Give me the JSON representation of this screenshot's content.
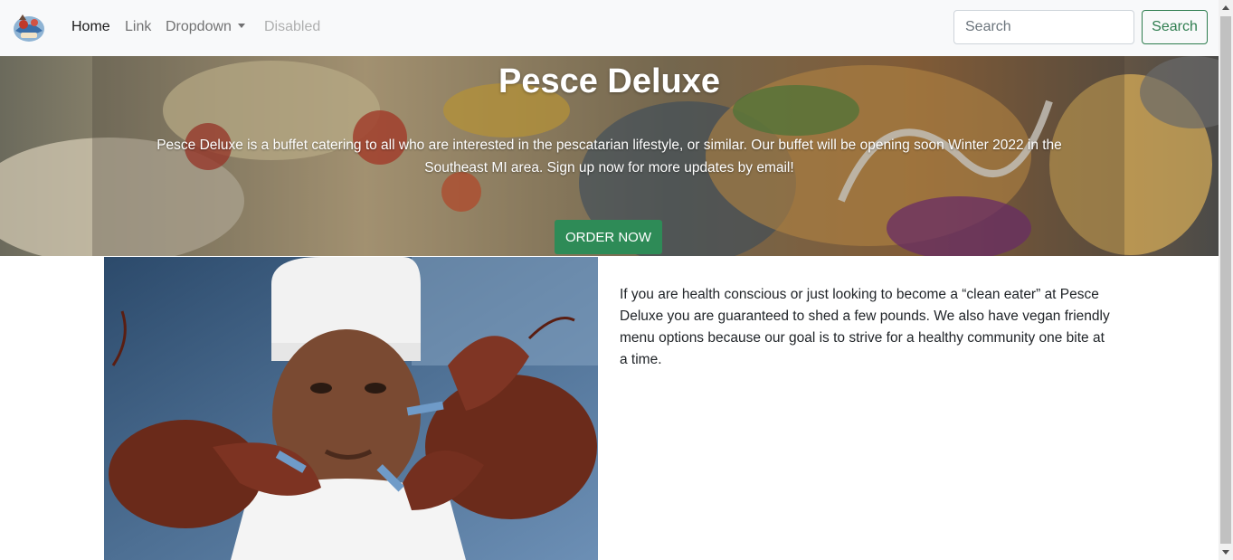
{
  "navbar": {
    "logo_icon": "pesce-deluxe-logo",
    "links": [
      {
        "label": "Home",
        "state": "active"
      },
      {
        "label": "Link",
        "state": "normal"
      },
      {
        "label": "Dropdown",
        "state": "normal"
      },
      {
        "label": "Disabled",
        "state": "disabled"
      }
    ],
    "search": {
      "placeholder": "Search",
      "value": "",
      "button_label": "Search"
    }
  },
  "hero": {
    "title": "Pesce Deluxe",
    "description": "Pesce Deluxe is a buffet catering to all who are interested in the pescatarian lifestyle, or similar. Our buffet will be opening soon Winter 2022 in the Southeast MI area. Sign up now for more updates by email!",
    "cta_label": "ORDER NOW",
    "background_image": "seafood-tacos-photo"
  },
  "about": {
    "image": "chef-holding-lobsters-photo",
    "text": "If you are health conscious or just looking to become a “clean eater” at Pesce Deluxe you are guaranteed to shed a few pounds. We also have vegan friendly menu options because our goal is to strive for a healthy community one bite at a time."
  },
  "colors": {
    "accent": "#2e8b57",
    "navbar_bg": "#f8f9fa"
  }
}
